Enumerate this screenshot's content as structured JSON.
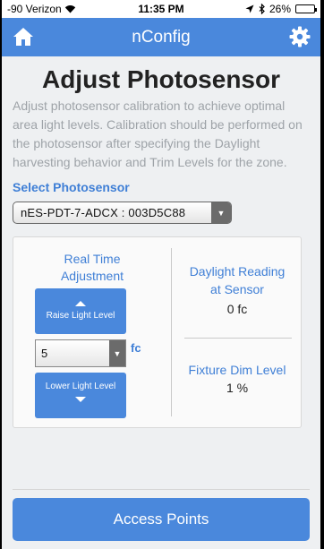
{
  "status_bar": {
    "carrier": "-90 Verizon",
    "time": "11:35 PM",
    "battery": "26%",
    "battery_level": 0.26
  },
  "navbar": {
    "title": "nConfig",
    "left_icon": "home-icon",
    "right_icon": "gear-icon"
  },
  "page": {
    "title": "Adjust Photosensor",
    "description": "Adjust photosensor calibration to achieve optimal area light levels. Calibration should be performed on the photosensor after specifying the Daylight harvesting behavior and Trim Levels for the zone.",
    "select_label": "Select Photosensor",
    "selected_photosensor": "nES-PDT-7-ADCX : 003D5C88"
  },
  "adjustment": {
    "label_line1": "Real Time",
    "label_line2": "Adjustment",
    "raise_label": "Raise Light Level",
    "level_value": "5",
    "unit": "fc",
    "lower_label": "Lower Light Level"
  },
  "readings": {
    "daylight_label_line1": "Daylight Reading",
    "daylight_label_line2": "at Sensor",
    "daylight_value": "0 fc",
    "fixture_label": "Fixture Dim Level",
    "fixture_value": "1 %"
  },
  "footer": {
    "access_points_label": "Access Points"
  },
  "colors": {
    "accent": "#4a88dc",
    "link_text": "#3f7fd6",
    "background": "#eef0f2"
  }
}
